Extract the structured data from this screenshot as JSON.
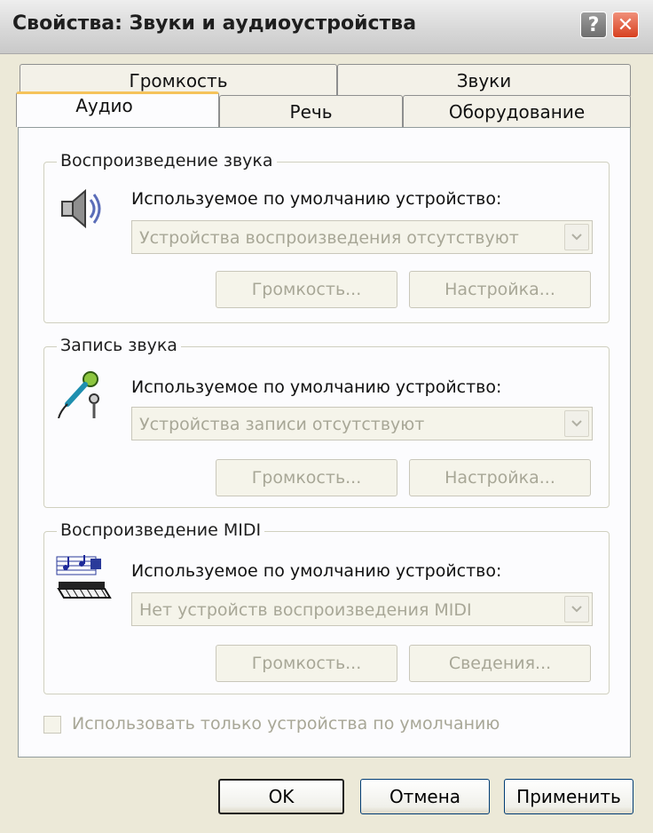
{
  "window": {
    "title": "Свойства: Звуки и аудиоустройства",
    "help_label": "?",
    "close_label": "✕"
  },
  "tabs": {
    "volume": "Громкость",
    "sounds": "Звуки",
    "audio": "Аудио",
    "speech": "Речь",
    "hardware": "Оборудование",
    "active": "audio"
  },
  "playback": {
    "legend": "Воспроизведение звука",
    "device_label": "Используемое по умолчанию устройство:",
    "device_value": "Устройства воспроизведения отсутствуют",
    "volume_button": "Громкость...",
    "settings_button": "Настройка...",
    "icon": "speaker-icon"
  },
  "recording": {
    "legend": "Запись звука",
    "device_label": "Используемое по умолчанию устройство:",
    "device_value": "Устройства записи отсутствуют",
    "volume_button": "Громкость...",
    "settings_button": "Настройка...",
    "icon": "microphone-icon"
  },
  "midi": {
    "legend": "Воспроизведение MIDI",
    "device_label": "Используемое по умолчанию устройство:",
    "device_value": "Нет устройств воспроизведения MIDI",
    "volume_button": "Громкость...",
    "info_button": "Сведения...",
    "icon": "midi-keyboard-icon"
  },
  "options": {
    "default_only_label": "Использовать только устройства по умолчанию",
    "default_only_checked": false
  },
  "buttons": {
    "ok": "OK",
    "cancel": "Отмена",
    "apply": "Применить"
  },
  "colors": {
    "dialog_bg": "#ECE9D8",
    "panel_bg": "#FCFCFE",
    "disabled_text": "#A8A797",
    "active_tab_accent": "#F5C35B",
    "close_button": "#D7401F"
  }
}
